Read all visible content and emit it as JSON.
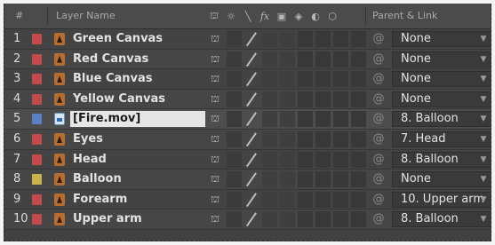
{
  "header": {
    "num_col": "#",
    "layer_name_col": "Layer Name",
    "parent_link_col": "Parent & Link",
    "switch_icons": [
      "shy-icon",
      "sun-icon",
      "slash-icon",
      "fx-icon",
      "motion-blur-icon",
      "adjustment-icon",
      "3d-layer-icon",
      "cube-icon"
    ]
  },
  "label_colors": {
    "red": "#c24a4a",
    "yellow": "#c8b44a",
    "blue": "#5b7fc4"
  },
  "layers": [
    {
      "num": "1",
      "name": "Green Canvas",
      "label_color": "#c24a4a",
      "type": "solid",
      "parent": "None"
    },
    {
      "num": "2",
      "name": "Red Canvas",
      "label_color": "#c24a4a",
      "type": "solid",
      "parent": "None"
    },
    {
      "num": "3",
      "name": "Blue Canvas",
      "label_color": "#c24a4a",
      "type": "solid",
      "parent": "None"
    },
    {
      "num": "4",
      "name": "Yellow Canvas",
      "label_color": "#c24a4a",
      "type": "solid",
      "parent": "None"
    },
    {
      "num": "5",
      "name": "[Fire.mov]",
      "label_color": "#5b7fc4",
      "type": "footage",
      "parent": "8. Balloon"
    },
    {
      "num": "6",
      "name": "Eyes",
      "label_color": "#c24a4a",
      "type": "solid",
      "parent": "7. Head"
    },
    {
      "num": "7",
      "name": "Head",
      "label_color": "#c24a4a",
      "type": "solid",
      "parent": "8. Balloon"
    },
    {
      "num": "8",
      "name": "Balloon",
      "label_color": "#c8b44a",
      "type": "solid",
      "parent": "None"
    },
    {
      "num": "9",
      "name": "Forearm",
      "label_color": "#c24a4a",
      "type": "solid",
      "parent": "10. Upper arm"
    },
    {
      "num": "10",
      "name": "Upper arm",
      "label_color": "#c24a4a",
      "type": "solid",
      "parent": "8. Balloon"
    }
  ]
}
